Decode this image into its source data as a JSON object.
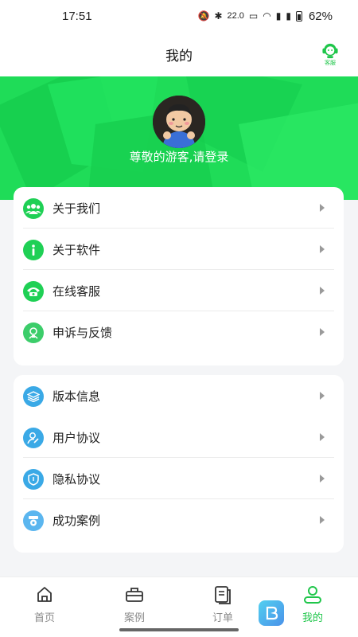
{
  "status_bar": {
    "time": "17:51",
    "net_speed": "22.0",
    "battery_percent": "62%"
  },
  "header": {
    "title": "我的",
    "service_label": "客服"
  },
  "profile": {
    "login_prompt": "尊敬的游客,请登录"
  },
  "menu_group_1": [
    {
      "label": "关于我们",
      "icon": "group-icon",
      "color": "#1fd055"
    },
    {
      "label": "关于软件",
      "icon": "info-icon",
      "color": "#1fd055"
    },
    {
      "label": "在线客服",
      "icon": "phone-icon",
      "color": "#1fd055"
    },
    {
      "label": "申诉与反馈",
      "icon": "feedback-icon",
      "color": "#3ccd6a"
    }
  ],
  "menu_group_2": [
    {
      "label": "版本信息",
      "icon": "layers-icon",
      "color": "#3aa9e6"
    },
    {
      "label": "用户协议",
      "icon": "user-agreement-icon",
      "color": "#3aa9e6"
    },
    {
      "label": "隐私协议",
      "icon": "shield-icon",
      "color": "#3aa9e6"
    },
    {
      "label": "成功案例",
      "icon": "badge-icon",
      "color": "#5bb6ef"
    }
  ],
  "bottom_nav": [
    {
      "label": "首页",
      "icon": "home-icon",
      "active": false
    },
    {
      "label": "案例",
      "icon": "briefcase-icon",
      "active": false
    },
    {
      "label": "订单",
      "icon": "orders-icon",
      "active": false
    },
    {
      "label": "我的",
      "icon": "profile-icon",
      "active": true
    }
  ],
  "colors": {
    "brand_green": "#1fdc58",
    "accent_blue": "#3aa9e6",
    "active_tab": "#1fc64a"
  }
}
